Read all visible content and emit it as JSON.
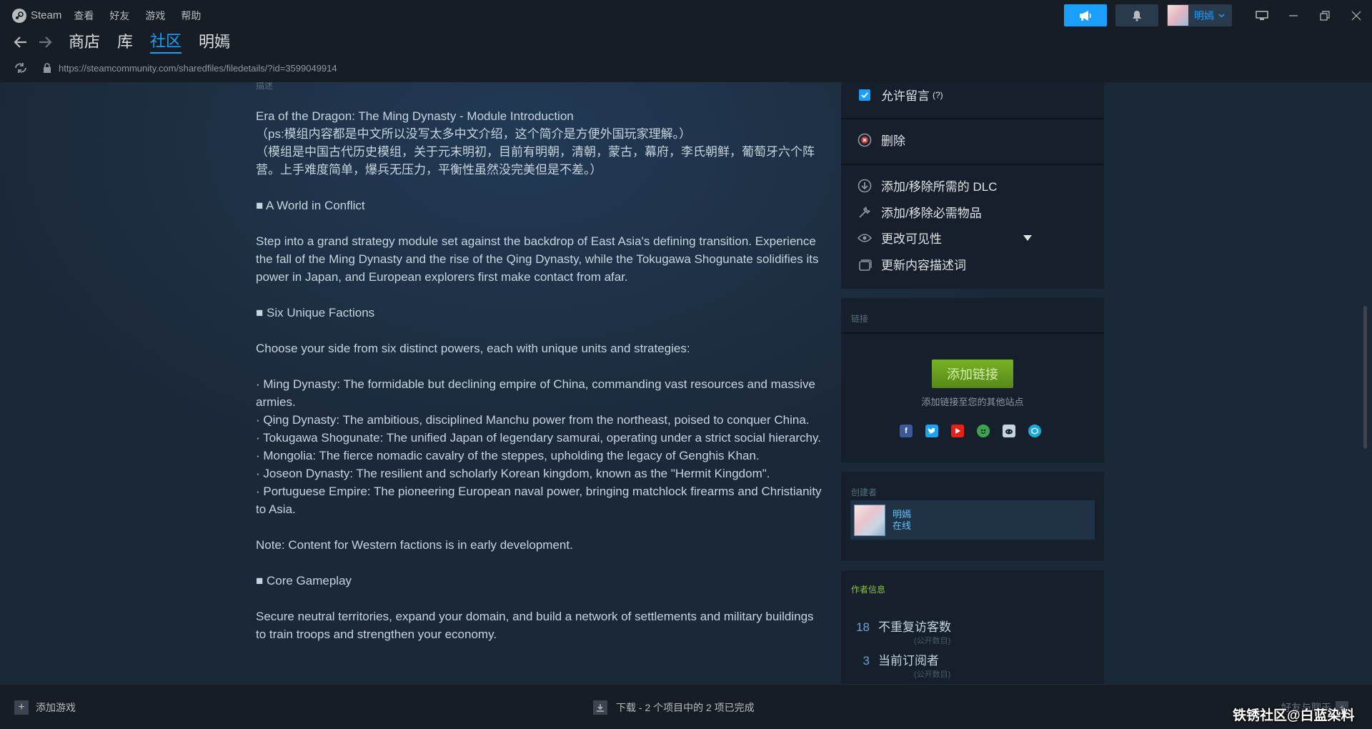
{
  "titlebar": {
    "app_name": "Steam",
    "menu": [
      "查看",
      "好友",
      "游戏",
      "帮助"
    ],
    "user_name": "明嫣"
  },
  "nav": {
    "tabs": [
      "商店",
      "库",
      "社区",
      "明嫣"
    ],
    "active_tab_index": 2
  },
  "url": "https://steamcommunity.com/sharedfiles/filedetails/?id=3599049914",
  "description": {
    "label": "描述",
    "paragraphs": [
      "Era of the Dragon: The Ming Dynasty - Module Introduction",
      "（ps:模组内容都是中文所以没写太多中文介绍，这个简介是方便外国玩家理解。）",
      "（模组是中国古代历史模组，关于元末明初，目前有明朝，清朝，蒙古，幕府，李氏朝鲜，葡萄牙六个阵营。上手难度简单，爆兵无压力，平衡性虽然没完美但是不差。）",
      "",
      "■ A World in Conflict",
      "",
      "Step into a grand strategy module set against the backdrop of East Asia's defining transition. Experience the fall of the Ming Dynasty and the rise of the Qing Dynasty, while the Tokugawa Shogunate solidifies its power in Japan, and European explorers first make contact from afar.",
      "",
      "■ Six Unique Factions",
      "",
      "Choose your side from six distinct powers, each with unique units and strategies:",
      "",
      "· Ming Dynasty: The formidable but declining empire of China, commanding vast resources and massive armies.",
      "· Qing Dynasty: The ambitious, disciplined Manchu power from the northeast, poised to conquer China.",
      "· Tokugawa Shogunate: The unified Japan of legendary samurai, operating under a strict social hierarchy.",
      "· Mongolia: The fierce nomadic cavalry of the steppes, upholding the legacy of Genghis Khan.",
      "· Joseon Dynasty: The resilient and scholarly Korean kingdom, known as the \"Hermit Kingdom\".",
      "· Portuguese Empire: The pioneering European naval power, bringing matchlock firearms and Christianity to Asia.",
      "",
      "Note: Content for Western factions is in early development.",
      "",
      "■ Core Gameplay",
      "",
      "Secure neutral territories, expand your domain, and build a network of settlements and military buildings to train troops and strengthen your economy."
    ]
  },
  "actions": {
    "allow_comments_label": "允许留言",
    "allow_comments_help": "(?)",
    "allow_comments_checked": true,
    "delete_label": "删除",
    "dlc_label": "添加/移除所需的 DLC",
    "required_items_label": "添加/移除必需物品",
    "visibility_label": "更改可见性",
    "update_desc_label": "更新内容描述词"
  },
  "links": {
    "header": "链接",
    "add_button": "添加链接",
    "subtitle": "添加链接至您的其他站点",
    "socials": [
      "facebook-icon",
      "twitter-icon",
      "youtube-icon",
      "steam-green-icon",
      "reddit-icon",
      "sketchfab-icon"
    ]
  },
  "creator": {
    "header": "创建者",
    "name": "明嫣",
    "status": "在线"
  },
  "author_info": {
    "header": "作者信息",
    "stats": [
      {
        "value": "18",
        "label": "不重复访客数",
        "sub": "(公开数目)"
      },
      {
        "value": "3",
        "label": "当前订阅者",
        "sub": "(公开数目)"
      }
    ]
  },
  "bottombar": {
    "add_game": "添加游戏",
    "download_status": "下载 - 2 个项目中的 2 项已完成",
    "friends_chat": "好友与聊天",
    "watermark": "铁锈社区@白蓝染料"
  },
  "colors": {
    "accent": "#1a9fff",
    "green_button": "#75b022",
    "background": "#1b2838",
    "panel": "#16202d"
  }
}
